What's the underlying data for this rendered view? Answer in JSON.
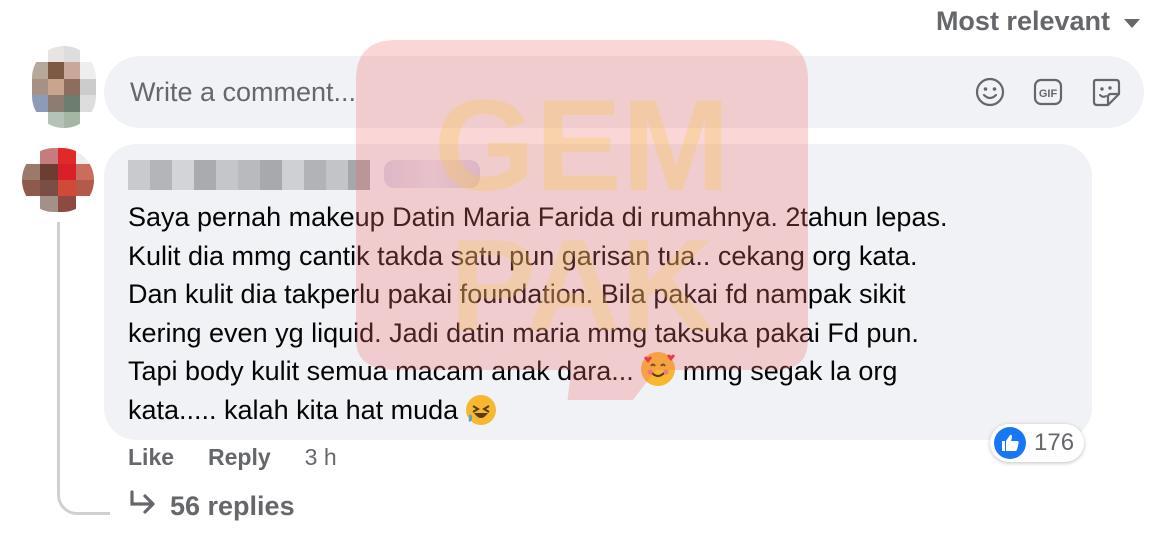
{
  "sort": {
    "label": "Most relevant"
  },
  "composer": {
    "placeholder": "Write a comment...",
    "icons": [
      "emoji-icon",
      "gif-icon",
      "sticker-icon"
    ]
  },
  "comment": {
    "lines": [
      "Saya pernah makeup Datin Maria Farida di rumahnya. 2tahun lepas.",
      "Kulit dia mmg cantik takda satu pun garisan tua.. cekang org kata.",
      "Dan kulit dia takperlu pakai foundation. Bila pakai fd nampak sikit",
      "kering even yg liquid. Jadi datin maria mmg taksuka pakai Fd pun.",
      "Tapi body kulit semua macam anak dara...",
      "mmg segak la org",
      "kata..... kalah kita hat muda"
    ],
    "reaction_count": "176",
    "actions": {
      "like": "Like",
      "reply": "Reply",
      "time": "3 h"
    },
    "replies_label": "56 replies"
  },
  "watermark": {
    "text": "GEMPAK"
  },
  "colors": {
    "bubble": "#f0f2f5",
    "muted": "#65676b",
    "like_blue": "#1877f2",
    "watermark": "#f26b6b"
  }
}
